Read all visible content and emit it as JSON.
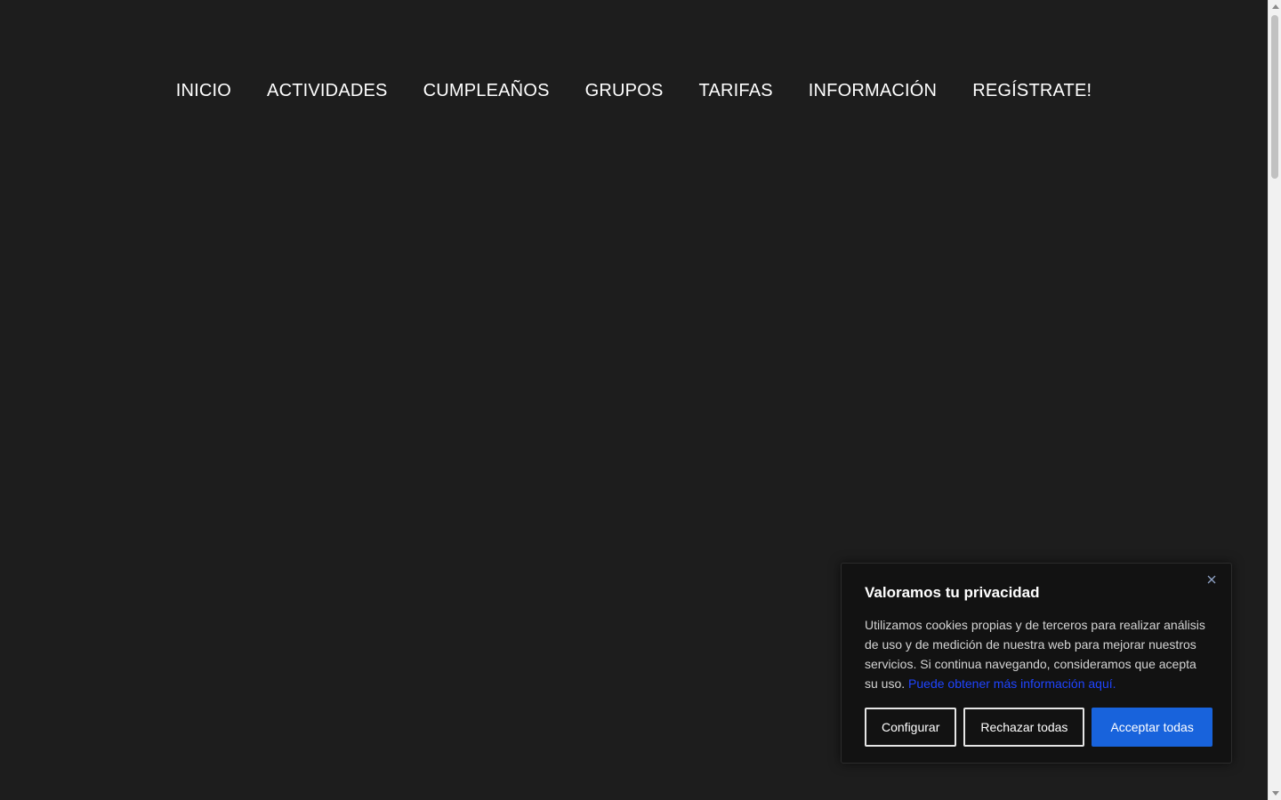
{
  "nav": {
    "items": [
      {
        "label": "INICIO"
      },
      {
        "label": "ACTIVIDADES"
      },
      {
        "label": "CUMPLEAÑOS"
      },
      {
        "label": "GRUPOS"
      },
      {
        "label": "TARIFAS"
      },
      {
        "label": "INFORMACIÓN"
      },
      {
        "label": "REGÍSTRATE!"
      }
    ]
  },
  "cookie_banner": {
    "title": "Valoramos tu privacidad",
    "text": "Utilizamos cookies propias y de terceros para realizar análisis de uso y de medición de nuestra web para mejorar nuestros servicios. Si continua navegando, consideramos que acepta su uso. ",
    "link_text": "Puede obtener más información aquí.",
    "buttons": {
      "configure": "Configurar",
      "reject": "Rechazar todas",
      "accept": "Acceptar todas"
    },
    "close_icon": "close-icon"
  },
  "colors": {
    "background": "#1d1d1d",
    "banner_background": "#121212",
    "accent": "#1863dc",
    "link": "#1f44ff"
  }
}
